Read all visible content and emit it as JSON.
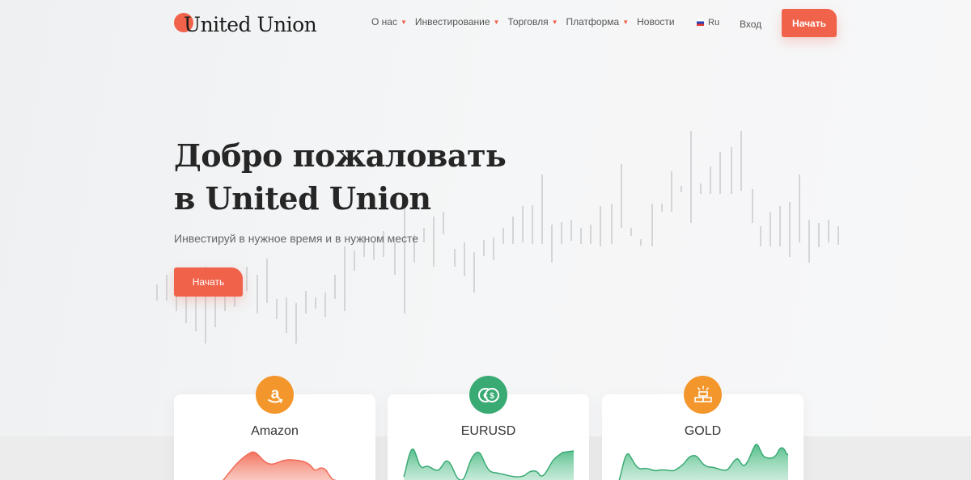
{
  "brand": {
    "name": "United Union",
    "accent": "#f1624b"
  },
  "nav": {
    "items": [
      {
        "label": "О нас",
        "dropdown": true
      },
      {
        "label": "Инвестирование",
        "dropdown": true
      },
      {
        "label": "Торговля",
        "dropdown": true
      },
      {
        "label": "Платформа",
        "dropdown": true
      },
      {
        "label": "Новости",
        "dropdown": false
      }
    ],
    "language": "Ru",
    "login_label": "Вход",
    "start_label": "Начать"
  },
  "hero": {
    "title_line1": "Добро пожаловать",
    "title_line2": "в United Union",
    "subtitle": "Инвестируй в нужное время и в нужном месте",
    "cta_label": "Начать"
  },
  "cards": [
    {
      "title": "Amazon",
      "icon": "amazon-icon",
      "icon_color": "#f3962b",
      "chart_color": "#f26a55"
    },
    {
      "title": "EURUSD",
      "icon": "currency-exchange-icon",
      "icon_color": "#3aaa74",
      "chart_color": "#5cc38f"
    },
    {
      "title": "GOLD",
      "icon": "gold-bars-icon",
      "icon_color": "#f3962b",
      "chart_color": "#5cc38f"
    }
  ]
}
